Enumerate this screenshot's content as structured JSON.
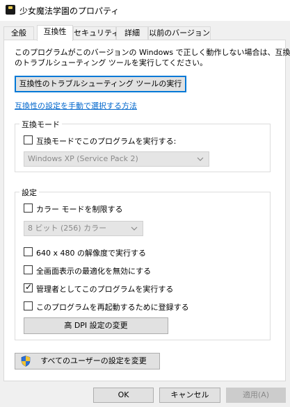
{
  "window": {
    "title": "少女魔法学園のプロパティ"
  },
  "tabs": [
    {
      "label": "全般"
    },
    {
      "label": "互換性"
    },
    {
      "label": "セキュリティ"
    },
    {
      "label": "詳細"
    },
    {
      "label": "以前のバージョン"
    }
  ],
  "compat": {
    "description_line1": "このプログラムがこのバージョンの Windows で正しく動作しない場合は、互換性",
    "description_line2": "のトラブルシューティング ツールを実行してください。",
    "troubleshooter_button": "互換性のトラブルシューティング ツールの実行",
    "manual_link": "互換性の設定を手動で選択する方法",
    "mode_group": {
      "title": "互換モード",
      "checkbox_label": "互換モードでこのプログラムを実行する:",
      "checked": false,
      "select_value": "Windows XP (Service Pack 2)"
    },
    "settings_group": {
      "title": "設定",
      "reduced_color": {
        "label": "カラー モードを制限する",
        "checked": false
      },
      "color_select_value": "8 ビット (256) カラー",
      "res_640": {
        "label": "640 x 480 の解像度で実行する",
        "checked": false
      },
      "disable_fullscreen": {
        "label": "全画面表示の最適化を無効にする",
        "checked": false
      },
      "run_as_admin": {
        "label": "管理者としてこのプログラムを実行する",
        "checked": true
      },
      "register_restart": {
        "label": "このプログラムを再起動するために登録する",
        "checked": false
      },
      "high_dpi_button": "高 DPI 設定の変更"
    },
    "all_users_button": "すべてのユーザーの設定を変更"
  },
  "footer": {
    "ok": "OK",
    "cancel": "キャンセル",
    "apply": "適用(A)"
  },
  "colors": {
    "link": "#0066cc",
    "focus": "#0078d7",
    "shield_blue": "#2b6fd6",
    "shield_gold": "#f2c230"
  }
}
